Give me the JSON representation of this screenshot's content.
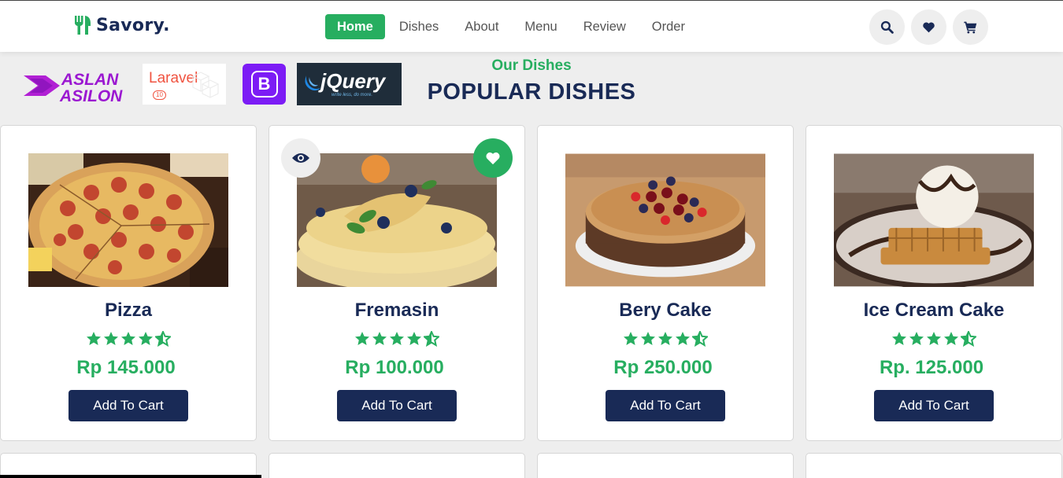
{
  "brand": {
    "name": "Savory.",
    "logo_icon": "utensils-icon"
  },
  "nav": {
    "items": [
      {
        "label": "Home",
        "active": true
      },
      {
        "label": "Dishes",
        "active": false
      },
      {
        "label": "About",
        "active": false
      },
      {
        "label": "Menu",
        "active": false
      },
      {
        "label": "Review",
        "active": false
      },
      {
        "label": "Order",
        "active": false
      }
    ]
  },
  "header_icons": [
    "search-icon",
    "heart-icon",
    "shopping-cart-icon"
  ],
  "tech_logos": {
    "aslan": [
      "ASLAN",
      "ASILON"
    ],
    "laravel": {
      "name": "Laravel",
      "version": "10"
    },
    "bootstrap": "B",
    "jquery": {
      "name": "jQuery",
      "tagline": "write less, do more."
    }
  },
  "section": {
    "subheading": "Our Dishes",
    "heading": "POPULAR DISHES"
  },
  "dishes": [
    {
      "name": "Pizza",
      "rating": 4.5,
      "price": "Rp 145.000",
      "button": "Add To Cart"
    },
    {
      "name": "Fremasin",
      "rating": 4.5,
      "price": "Rp 100.000",
      "button": "Add To Cart"
    },
    {
      "name": "Bery Cake",
      "rating": 4.5,
      "price": "Rp 250.000",
      "button": "Add To Cart"
    },
    {
      "name": "Ice Cream Cake",
      "rating": 4.5,
      "price": "Rp. 125.000",
      "button": "Add To Cart"
    }
  ],
  "colors": {
    "primary": "#192a56",
    "accent": "#27ae60",
    "background": "#eeeeee"
  }
}
